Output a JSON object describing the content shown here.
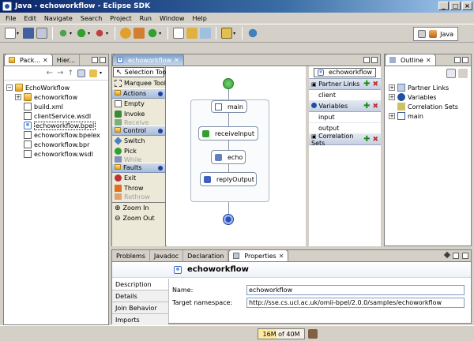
{
  "window": {
    "title": "Java - echoworkflow - Eclipse SDK",
    "controls": [
      "_",
      "□",
      "×"
    ]
  },
  "menu": [
    "File",
    "Edit",
    "Navigate",
    "Search",
    "Project",
    "Run",
    "Window",
    "Help"
  ],
  "perspective": {
    "label": "Java"
  },
  "packageExplorer": {
    "tabs": [
      "Pack...",
      "Hier..."
    ],
    "tree": {
      "project": "EchoWorkflow",
      "folder": "echoworkflow",
      "files": [
        "build.xml",
        "clientService.wsdl",
        "echoworkflow.bpel",
        "echoworkflow.bpelex",
        "echoworkflow.bpr",
        "echoworkflow.wsdl"
      ]
    }
  },
  "editor": {
    "tab": "echoworkflow"
  },
  "palette": {
    "tools": [
      "Selection Tool",
      "Marquee Tool"
    ],
    "actions": {
      "label": "Actions",
      "items": [
        "Empty",
        "Invoke",
        "Receive"
      ]
    },
    "control": {
      "label": "Control",
      "items": [
        "Switch",
        "Pick",
        "While"
      ]
    },
    "faults": {
      "label": "Faults",
      "items": [
        "Exit",
        "Throw",
        "Rethrow"
      ]
    },
    "zoom": [
      "Zoom In",
      "Zoom Out"
    ]
  },
  "canvas": {
    "sequence": "main",
    "nodes": [
      "receiveInput",
      "echo",
      "replyOutput"
    ]
  },
  "details": {
    "process": "echoworkflow",
    "partnerLinks": {
      "label": "Partner Links",
      "items": [
        "client"
      ]
    },
    "variables": {
      "label": "Variables",
      "items": [
        "input",
        "output"
      ]
    },
    "correlationSets": {
      "label": "Correlation Sets"
    }
  },
  "outline": {
    "tab": "Outline",
    "items": [
      "Partner Links",
      "Variables",
      "Correlation Sets",
      "main"
    ]
  },
  "bottomTabs": [
    "Problems",
    "Javadoc",
    "Declaration",
    "Properties"
  ],
  "properties": {
    "title": "echoworkflow",
    "tabs": [
      "Description",
      "Details",
      "Join Behavior",
      "Imports"
    ],
    "nameLabel": "Name:",
    "nameValue": "echoworkflow",
    "nsLabel": "Target namespace:",
    "nsValue": "http://sse.cs.ucl.ac.uk/omii-bpel/2.0.0/samples/echoworkflow"
  },
  "status": {
    "heap": "16M of 40M"
  }
}
